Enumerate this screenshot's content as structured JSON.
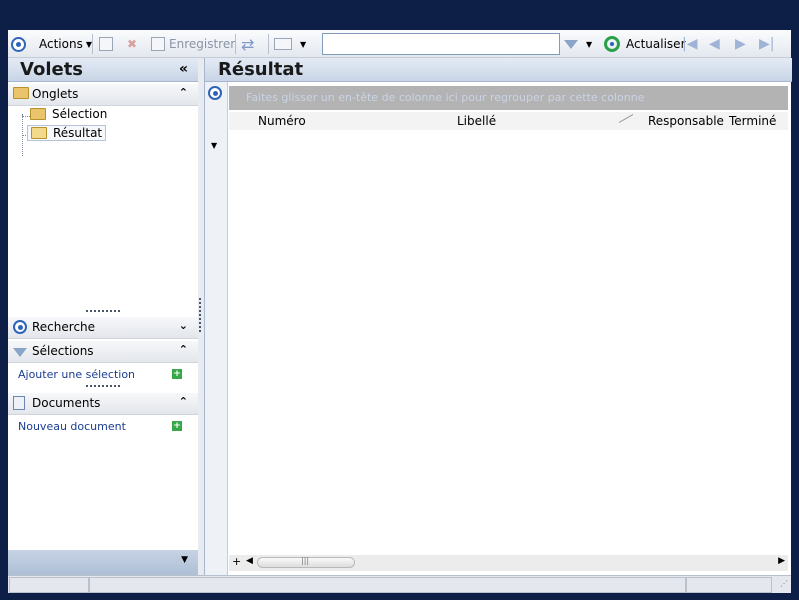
{
  "toolbar": {
    "actions_label": "Actions",
    "save_label": "Enregistrer",
    "search_value": "",
    "refresh_label": "Actualiser"
  },
  "left_panel": {
    "title": "Volets",
    "collapse_glyph": "«",
    "tabs_section": {
      "label": "Onglets",
      "items": [
        {
          "label": "Sélection"
        },
        {
          "label": "Résultat"
        }
      ]
    },
    "search_section": {
      "label": "Recherche"
    },
    "selections_section": {
      "label": "Sélections",
      "add_link": "Ajouter une sélection"
    },
    "documents_section": {
      "label": "Documents",
      "new_link": "Nouveau document"
    }
  },
  "result_panel": {
    "title": "Résultat",
    "group_hint": "Faites glisser un en-tête de colonne ici pour regrouper par cette colonne",
    "columns": [
      "Numéro",
      "Libellé",
      "Responsable",
      "Terminé"
    ]
  },
  "colors": {
    "background": "#0d1f47",
    "accent_blue": "#2d63b8",
    "header_gradient_top": "#e4ebf5",
    "refresh_green": "#2aa04a"
  }
}
